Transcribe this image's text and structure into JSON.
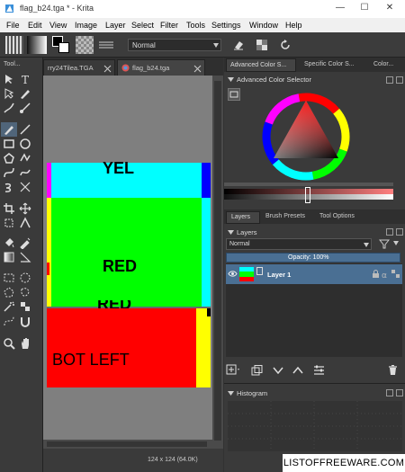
{
  "window": {
    "title": "flag_b24.tga * - Krita",
    "minimize": "—",
    "maximize": "☐",
    "close": "✕"
  },
  "menu": [
    "File",
    "Edit",
    "View",
    "Image",
    "Layer",
    "Select",
    "Filter",
    "Tools",
    "Settings",
    "Window",
    "Help"
  ],
  "toolbar": {
    "blend_mode": "Normal"
  },
  "toolbox": {
    "header": "Tool..."
  },
  "tabs": [
    {
      "label": "rry24Tilea.TGA"
    },
    {
      "label": "flag_b24.tga"
    }
  ],
  "canvas": {
    "labels": {
      "top": "YEL",
      "middle": "RED",
      "cut": "RED",
      "bottom": "BOT LEFT"
    }
  },
  "statusbar": {
    "size": "124 x 124 (64.0K)"
  },
  "dock_tabs": [
    "Advanced Color S...",
    "Specific Color S...",
    "Color..."
  ],
  "color_selector": {
    "title": "Advanced Color Selector"
  },
  "layer_tabs": [
    "Layers",
    "Brush Presets",
    "Tool Options"
  ],
  "layers": {
    "title": "Layers",
    "blend_mode": "Normal",
    "opacity_label": "Opacity:  100%",
    "items": [
      {
        "name": "Layer 1"
      }
    ]
  },
  "histogram": {
    "title": "Histogram"
  },
  "watermark": "LISTOFFREEWARE.COM",
  "colors": {
    "cyan": "#00ffff",
    "green": "#00ff00",
    "red": "#ff0000",
    "yellow": "#ffff00",
    "blue": "#0000ff",
    "magenta": "#ff00ff",
    "selected_layer": "#4a6f93"
  }
}
